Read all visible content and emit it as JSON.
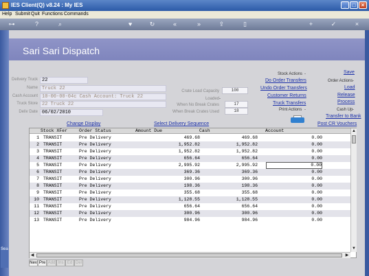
{
  "window": {
    "title": "IES Client(Q) v8.24 : My IES"
  },
  "menu": [
    "Help",
    "Submit",
    "Quit",
    "Functions",
    "Commands"
  ],
  "toolbar_icons": [
    "key-icon",
    "help-icon",
    "search-icon",
    "heart-icon",
    "refresh-icon",
    "rewind-icon",
    "forward-icon",
    "upload-icon",
    "document-icon",
    "add-icon",
    "check-icon",
    "close-icon"
  ],
  "page": {
    "title": "Sari Sari Dispatch"
  },
  "form": {
    "delivery_truck_label": "Delivery Truck",
    "delivery_truck": "22",
    "name_label": "Name",
    "name": "Truck 22",
    "cash_account_label": "Cash Account",
    "cash_account": "10-00-00-04c Cash Account: Truck 22",
    "truck_store_label": "Truck Store",
    "truck_store": "22 Truck 22",
    "date_label": "Deliv Date",
    "date": "06/02/2010",
    "crate_capacity_label": "Crate Load Capacity",
    "crate_capacity": "100",
    "loaded_label": "Loaded",
    "loaded": "-",
    "no_break_label": "When No Break Crates",
    "no_break": "17",
    "break_used_label": "When Break Crates Used",
    "break_used": "18"
  },
  "actions": {
    "stock_actions_label": "Stock Actions",
    "stock_actions_value": "-",
    "do_order_transfers": "Do Order Transfers",
    "undo_order_transfers": "Undo Order Transfers",
    "customer_returns": "Customer Returns",
    "truck_transfers": "Truck Transfers",
    "print_actions_label": "Print Actions",
    "print_actions_value": "-",
    "save": "Save",
    "order_actions_label": "Order Actions",
    "order_actions_value": "-",
    "load": "Load",
    "release": "Release",
    "process": "Process",
    "cash_up_label": "Cash Up",
    "cash_up_value": "-",
    "transfer_to_bank": "Transfer to Bank",
    "post_cr_vouchers": "Post CR Vouchers",
    "change_display": "Change Display",
    "select_delivery_sequence": "Select Delivery Sequence"
  },
  "grid": {
    "columns": [
      "Stock XFer",
      "Order Status",
      "Amount Due",
      "Cash",
      "Account"
    ],
    "rows": [
      [
        "1",
        "TRANSIT",
        "Pre Delivery",
        "469.68",
        "469.68",
        "0.00"
      ],
      [
        "2",
        "TRANSIT",
        "Pre Delivery",
        "1,952.82",
        "1,952.82",
        "0.00"
      ],
      [
        "3",
        "TRANSIT",
        "Pre Delivery",
        "1,952.82",
        "1,952.82",
        "0.00"
      ],
      [
        "4",
        "TRANSIT",
        "Pre Delivery",
        "656.64",
        "656.64",
        "0.00"
      ],
      [
        "5",
        "TRANSIT",
        "Pre Delivery",
        "2,995.92",
        "2,995.92",
        "0.00"
      ],
      [
        "6",
        "TRANSIT",
        "Pre Delivery",
        "369.36",
        "369.36",
        "0.00"
      ],
      [
        "7",
        "TRANSIT",
        "Pre Delivery",
        "300.96",
        "300.96",
        "0.00"
      ],
      [
        "8",
        "TRANSIT",
        "Pre Delivery",
        "198.36",
        "198.36",
        "0.00"
      ],
      [
        "9",
        "TRANSIT",
        "Pre Delivery",
        "355.68",
        "355.68",
        "0.00"
      ],
      [
        "10",
        "TRANSIT",
        "Pre Delivery",
        "1,128.55",
        "1,128.55",
        "0.00"
      ],
      [
        "11",
        "TRANSIT",
        "Pre Delivery",
        "656.64",
        "656.64",
        "0.00"
      ],
      [
        "12",
        "TRANSIT",
        "Pre Delivery",
        "300.96",
        "300.96",
        "0.00"
      ],
      [
        "13",
        "TRANSIT",
        "Pre Delivery",
        "984.96",
        "984.96",
        "0.00"
      ]
    ],
    "selected_row": 5
  },
  "bottom_tabs": [
    "Nev",
    "Pre",
    "Add",
    "Ins",
    "Ed",
    "Del"
  ],
  "side_tag": "Sea"
}
